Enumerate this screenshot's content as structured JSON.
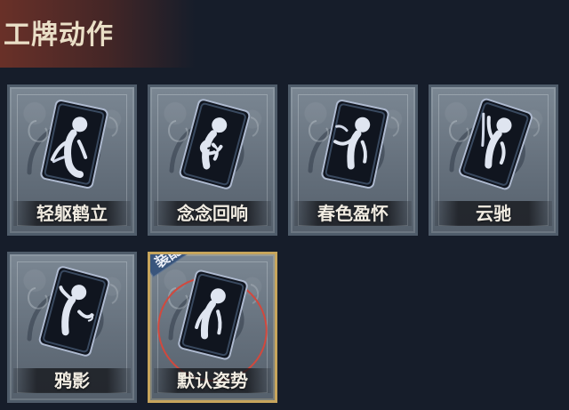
{
  "header": {
    "title": "工牌动作"
  },
  "cards": [
    {
      "label": "轻躯鹤立",
      "pose_icon": "pose-balanced-icon"
    },
    {
      "label": "念念回响",
      "pose_icon": "pose-hug-icon"
    },
    {
      "label": "春色盈怀",
      "pose_icon": "pose-wave-icon"
    },
    {
      "label": "云驰",
      "pose_icon": "pose-reach-icon"
    },
    {
      "label": "鸦影",
      "pose_icon": "pose-salute-icon"
    },
    {
      "label": "默认姿势",
      "pose_icon": "pose-default-icon",
      "badge": "装配",
      "selected": true
    }
  ],
  "colors": {
    "background": "#161d2a",
    "card_frame": "#4f5c6a",
    "selected_frame": "#c7a55c",
    "badge": "#39557c",
    "selection_highlight": "#d2483d"
  }
}
